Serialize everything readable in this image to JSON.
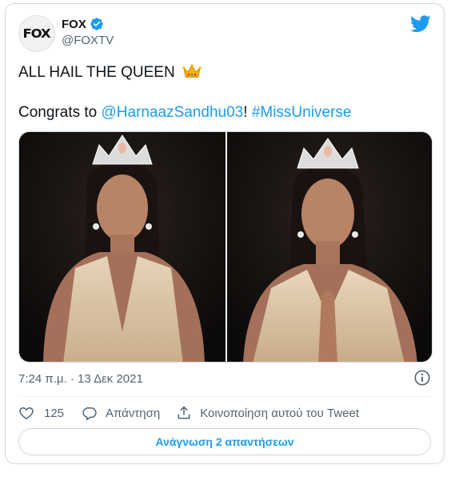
{
  "account": {
    "display_name": "FOX",
    "handle": "@FOXTV",
    "avatar_text": "FOX"
  },
  "tweet": {
    "line1": "ALL HAIL THE QUEEN",
    "line2_prefix": "Congrats to ",
    "mention": "@HarnaazSandhu03",
    "line2_mid": "! ",
    "hashtag": "#MissUniverse",
    "emoji": "crown"
  },
  "meta": {
    "time": "7:24 π.μ.",
    "separator": " · ",
    "date": "13 Δεκ 2021"
  },
  "actions": {
    "like_count": "125",
    "reply_label": "Απάντηση",
    "share_label": "Κοινοποίηση αυτού του Tweet"
  },
  "read_replies_label": "Ανάγνωση 2 απαντήσεων",
  "colors": {
    "accent": "#1d9bf0",
    "text": "#0f1419",
    "secondary": "#536471",
    "border": "#cfd9de"
  },
  "icons": [
    "verified-badge-icon",
    "twitter-bird-icon",
    "crown-emoji-icon",
    "info-icon",
    "heart-icon",
    "reply-icon",
    "share-icon"
  ]
}
